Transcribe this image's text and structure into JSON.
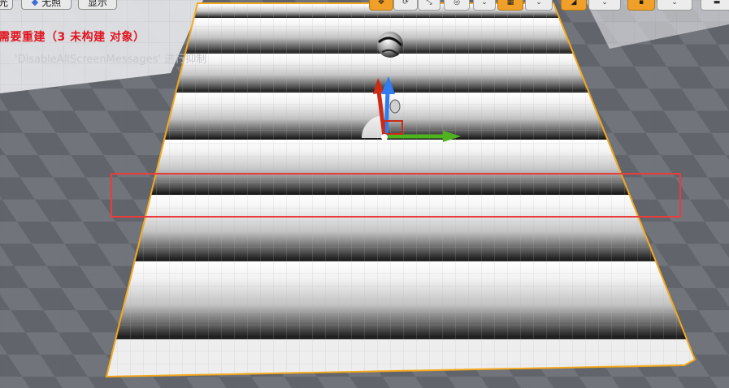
{
  "toolbar_left": {
    "partial_label": "光",
    "unlit_label": "无照",
    "show_label": "显示"
  },
  "toolbar_right": {
    "tools": [
      {
        "name": "translate-tool",
        "glyph": "✥",
        "active": true
      },
      {
        "name": "rotate-tool",
        "glyph": "⟳",
        "active": false
      },
      {
        "name": "scale-tool",
        "glyph": "⤡",
        "active": false
      },
      {
        "name": "world-local-toggle",
        "glyph": "◎",
        "active": false
      },
      {
        "name": "surface-snap",
        "glyph": "⌄",
        "active": false
      },
      {
        "name": "grid-snap-toggle",
        "glyph": "▦",
        "active": true
      },
      {
        "name": "grid-snap-value",
        "glyph": "⌄",
        "active": false
      },
      {
        "name": "rotation-snap-toggle",
        "glyph": "◢",
        "active": true
      },
      {
        "name": "rotation-snap-value",
        "glyph": "⌄",
        "active": false
      },
      {
        "name": "scale-snap-toggle",
        "glyph": "▪",
        "active": true
      },
      {
        "name": "scale-snap-value",
        "glyph": "⌄",
        "active": false
      },
      {
        "name": "camera-speed",
        "glyph": "▬",
        "active": false
      }
    ]
  },
  "messages": {
    "warning": "需要重建（3 未构建 对象）",
    "hint": "'DisableAllScreenMessages' 进行抑制"
  },
  "colors": {
    "selection_outline": "#f4a81d",
    "highlight_box": "#ec3b3b",
    "warning_text": "#e0141e",
    "gizmo_x": "#4fb31f",
    "gizmo_y": "#cc2b16",
    "gizmo_z": "#2f7df1"
  }
}
